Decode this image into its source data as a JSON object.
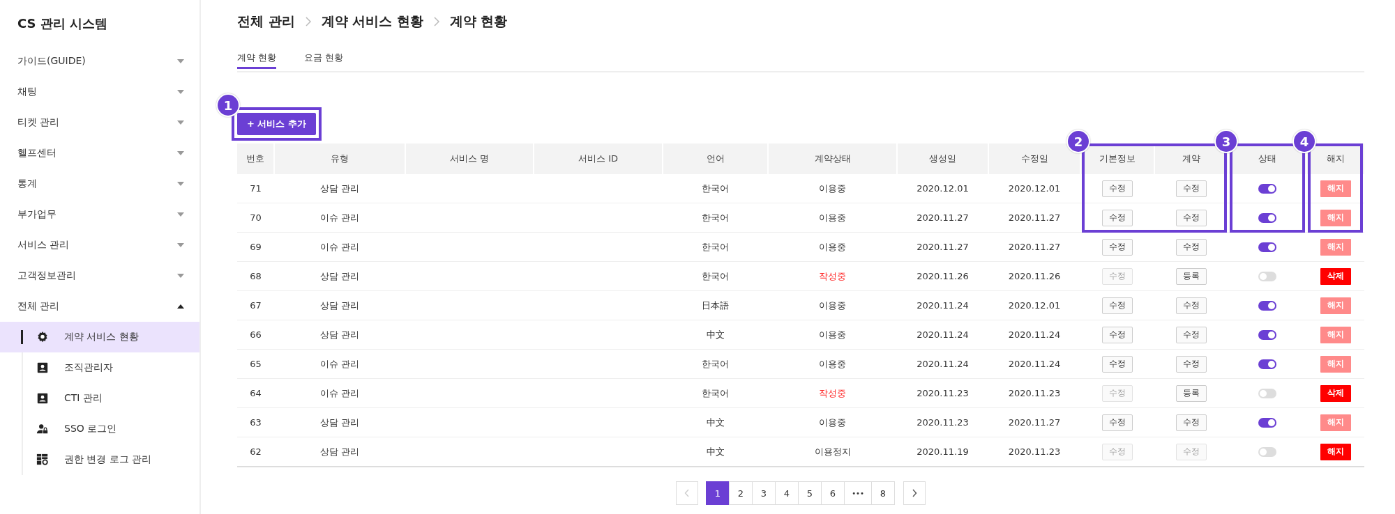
{
  "sidebar": {
    "title": "CS 관리 시스템",
    "items": [
      {
        "label": "가이드(GUIDE)",
        "expanded": false
      },
      {
        "label": "채팅",
        "expanded": false
      },
      {
        "label": "티켓 관리",
        "expanded": false
      },
      {
        "label": "헬프센터",
        "expanded": false
      },
      {
        "label": "통계",
        "expanded": false
      },
      {
        "label": "부가업무",
        "expanded": false
      },
      {
        "label": "서비스 관리",
        "expanded": false
      },
      {
        "label": "고객정보관리",
        "expanded": false
      },
      {
        "label": "전체 관리",
        "expanded": true,
        "children": [
          {
            "label": "계약 서비스 현황",
            "kind": "gear",
            "selected": true
          },
          {
            "label": "조직관리자",
            "kind": "card",
            "selected": false
          },
          {
            "label": "CTI 관리",
            "kind": "card",
            "selected": false
          },
          {
            "label": "SSO 로그인",
            "kind": "userlock",
            "selected": false
          },
          {
            "label": "권한 변경 로그 관리",
            "kind": "gridgear",
            "selected": false
          }
        ]
      }
    ]
  },
  "breadcrumb": [
    "전체 관리",
    "계약 서비스 현황",
    "계약 현황"
  ],
  "tabs": [
    {
      "label": "계약 현황",
      "selected": true
    },
    {
      "label": "요금 현황",
      "selected": false
    }
  ],
  "add_button": {
    "label": "+ 서비스 추가",
    "marker": "1"
  },
  "table": {
    "columns": [
      {
        "label": "번호",
        "marked": false
      },
      {
        "label": "유형",
        "marked": false
      },
      {
        "label": "서비스 명",
        "marked": false
      },
      {
        "label": "서비스 ID",
        "marked": false
      },
      {
        "label": "언어",
        "marked": false
      },
      {
        "label": "계약상태",
        "marked": false
      },
      {
        "label": "생성일",
        "marked": false
      },
      {
        "label": "수정일",
        "marked": false
      },
      {
        "label": "기본정보",
        "marked": true,
        "marker": "2"
      },
      {
        "label": "계약",
        "marked": true
      },
      {
        "label": "상태",
        "marked": true,
        "marker": "3"
      },
      {
        "label": "해지",
        "marked": true,
        "marker": "4"
      }
    ],
    "rows": [
      {
        "number": "71",
        "type": "상담 관리",
        "language": "한국어",
        "status": "이용중",
        "status_alert": false,
        "created": "2020.12.01",
        "modified": "2020.12.01",
        "info_button": {
          "label": "수정",
          "disabled": false
        },
        "contract_button": {
          "label": "수정",
          "disabled": false
        },
        "on": true,
        "end_button": {
          "label": "해지",
          "disabled": true
        },
        "marked": true
      },
      {
        "number": "70",
        "type": "이슈 관리",
        "language": "한국어",
        "status": "이용중",
        "status_alert": false,
        "created": "2020.11.27",
        "modified": "2020.11.27",
        "info_button": {
          "label": "수정",
          "disabled": false
        },
        "contract_button": {
          "label": "수정",
          "disabled": false
        },
        "on": true,
        "end_button": {
          "label": "해지",
          "disabled": true
        },
        "marked": true
      },
      {
        "number": "69",
        "type": "이슈 관리",
        "language": "한국어",
        "status": "이용중",
        "status_alert": false,
        "created": "2020.11.27",
        "modified": "2020.11.27",
        "info_button": {
          "label": "수정",
          "disabled": false
        },
        "contract_button": {
          "label": "수정",
          "disabled": false
        },
        "on": true,
        "end_button": {
          "label": "해지",
          "disabled": true
        },
        "marked": false
      },
      {
        "number": "68",
        "type": "상담 관리",
        "language": "한국어",
        "status": "작성중",
        "status_alert": true,
        "created": "2020.11.26",
        "modified": "2020.11.26",
        "info_button": {
          "label": "수정",
          "disabled": true
        },
        "contract_button": {
          "label": "등록",
          "disabled": false
        },
        "on": false,
        "end_button": {
          "label": "삭제",
          "disabled": false
        },
        "marked": false
      },
      {
        "number": "67",
        "type": "상담 관리",
        "language": "日本語",
        "status": "이용중",
        "status_alert": false,
        "created": "2020.11.24",
        "modified": "2020.12.01",
        "info_button": {
          "label": "수정",
          "disabled": false
        },
        "contract_button": {
          "label": "수정",
          "disabled": false
        },
        "on": true,
        "end_button": {
          "label": "해지",
          "disabled": true
        },
        "marked": false
      },
      {
        "number": "66",
        "type": "상담 관리",
        "language": "中文",
        "status": "이용중",
        "status_alert": false,
        "created": "2020.11.24",
        "modified": "2020.11.24",
        "info_button": {
          "label": "수정",
          "disabled": false
        },
        "contract_button": {
          "label": "수정",
          "disabled": false
        },
        "on": true,
        "end_button": {
          "label": "해지",
          "disabled": true
        },
        "marked": false
      },
      {
        "number": "65",
        "type": "이슈 관리",
        "language": "한국어",
        "status": "이용중",
        "status_alert": false,
        "created": "2020.11.24",
        "modified": "2020.11.24",
        "info_button": {
          "label": "수정",
          "disabled": false
        },
        "contract_button": {
          "label": "수정",
          "disabled": false
        },
        "on": true,
        "end_button": {
          "label": "해지",
          "disabled": true
        },
        "marked": false
      },
      {
        "number": "64",
        "type": "이슈 관리",
        "language": "한국어",
        "status": "작성중",
        "status_alert": true,
        "created": "2020.11.23",
        "modified": "2020.11.23",
        "info_button": {
          "label": "수정",
          "disabled": true
        },
        "contract_button": {
          "label": "등록",
          "disabled": false
        },
        "on": false,
        "end_button": {
          "label": "삭제",
          "disabled": false
        },
        "marked": false
      },
      {
        "number": "63",
        "type": "상담 관리",
        "language": "中文",
        "status": "이용중",
        "status_alert": false,
        "created": "2020.11.23",
        "modified": "2020.11.27",
        "info_button": {
          "label": "수정",
          "disabled": false
        },
        "contract_button": {
          "label": "수정",
          "disabled": false
        },
        "on": true,
        "end_button": {
          "label": "해지",
          "disabled": true
        },
        "marked": false
      },
      {
        "number": "62",
        "type": "상담 관리",
        "language": "中文",
        "status": "이용정지",
        "status_alert": false,
        "created": "2020.11.19",
        "modified": "2020.11.23",
        "info_button": {
          "label": "수정",
          "disabled": true
        },
        "contract_button": {
          "label": "수정",
          "disabled": true
        },
        "on": false,
        "end_button": {
          "label": "해지",
          "disabled": false
        },
        "marked": false
      }
    ]
  },
  "pagination": {
    "prev_disabled": true,
    "pages": [
      {
        "label": "1",
        "kind": "page",
        "selected": true
      },
      {
        "label": "2",
        "kind": "page",
        "selected": false
      },
      {
        "label": "3",
        "kind": "page",
        "selected": false
      },
      {
        "label": "4",
        "kind": "page",
        "selected": false
      },
      {
        "label": "5",
        "kind": "page",
        "selected": false
      },
      {
        "label": "6",
        "kind": "page",
        "selected": false
      },
      {
        "label": "•••",
        "kind": "ellipsis",
        "selected": false
      },
      {
        "label": "8",
        "kind": "page",
        "selected": false
      }
    ]
  }
}
